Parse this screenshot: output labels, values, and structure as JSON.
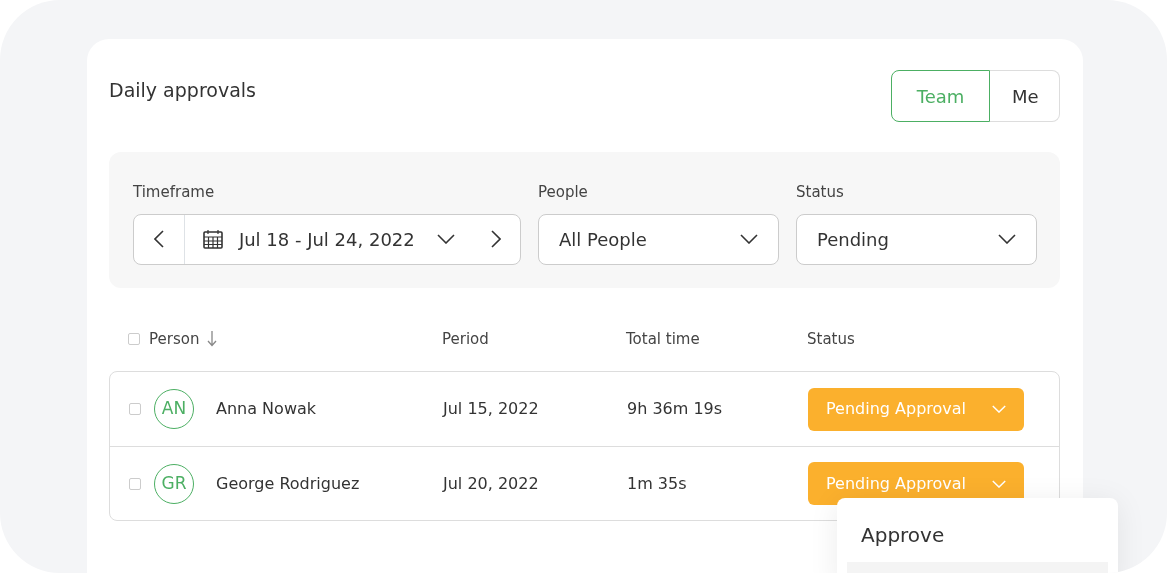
{
  "title": "Daily approvals",
  "view_toggle": [
    {
      "label": "Team",
      "selected": true
    },
    {
      "label": "Me",
      "selected": false
    }
  ],
  "filters": {
    "timeframe": {
      "label": "Timeframe",
      "value": "Jul 18 - Jul 24, 2022"
    },
    "people": {
      "label": "People",
      "value": "All People"
    },
    "status": {
      "label": "Status",
      "value": "Pending"
    }
  },
  "table": {
    "select_all_checked": false,
    "columns": [
      {
        "label": "Person",
        "sorted": true
      },
      {
        "label": "Period",
        "sorted": false
      },
      {
        "label": "Total time",
        "sorted": false
      },
      {
        "label": "Status",
        "sorted": false
      }
    ],
    "rows": [
      {
        "checked": false,
        "initials": "AN",
        "name": "Anna Nowak",
        "period": "Jul 15, 2022",
        "total_time": "9h 36m 19s",
        "status": "Pending Approval"
      },
      {
        "checked": false,
        "initials": "GR",
        "name": "George Rodriguez",
        "period": "Jul 20, 2022",
        "total_time": "1m 35s",
        "status": "Pending Approval"
      }
    ]
  },
  "status_menu": {
    "items": [
      "Approve"
    ]
  }
}
